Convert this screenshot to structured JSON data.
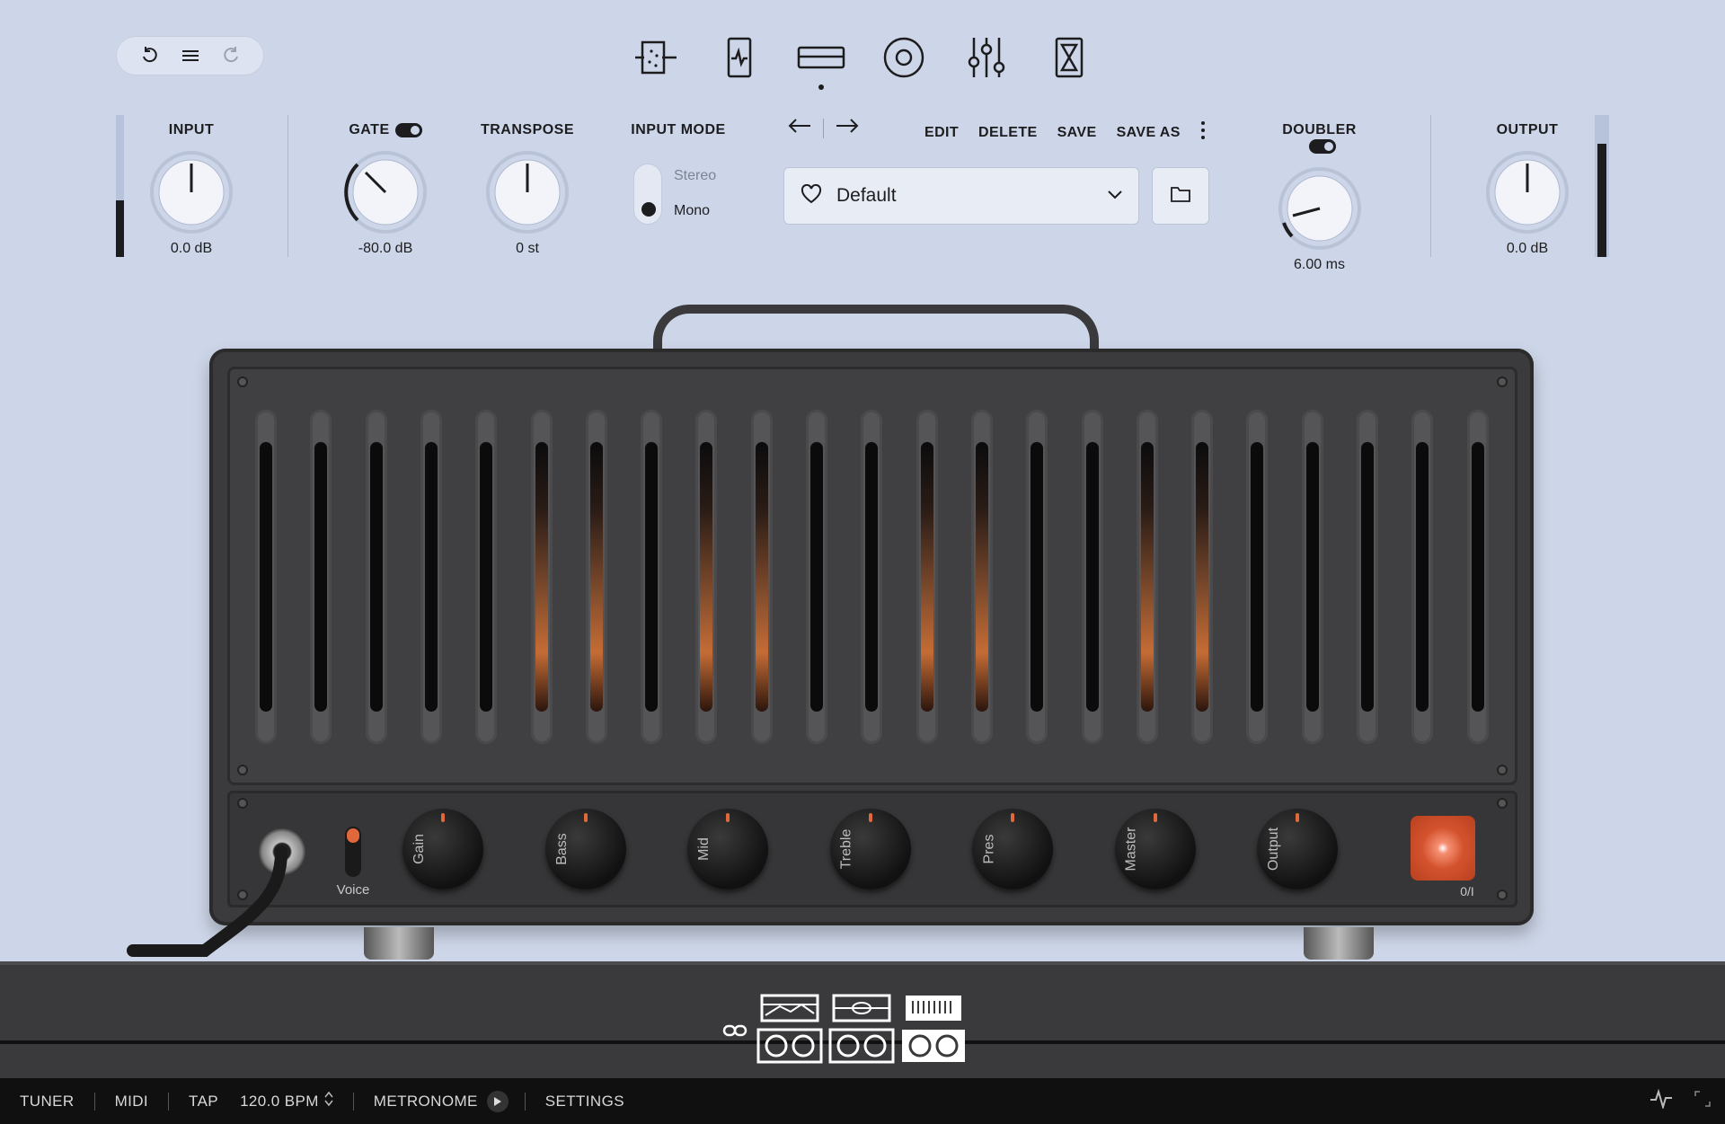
{
  "toolbar": {
    "undo_icon": "undo-icon",
    "menu_icon": "hamburger-icon",
    "redo_icon": "redo-icon"
  },
  "top_nav": {
    "items": [
      {
        "icon": "input-noise-icon"
      },
      {
        "icon": "pedal-icon"
      },
      {
        "icon": "amp-head-icon",
        "active": true
      },
      {
        "icon": "speaker-cab-icon"
      },
      {
        "icon": "mixer-sliders-icon"
      },
      {
        "icon": "hourglass-icon"
      }
    ]
  },
  "controls": {
    "input": {
      "label": "INPUT",
      "value": "0.0 dB"
    },
    "gate": {
      "label": "GATE",
      "value": "-80.0 dB",
      "enabled": true
    },
    "transpose": {
      "label": "TRANSPOSE",
      "value": "0 st"
    },
    "input_mode": {
      "label": "INPUT MODE",
      "options": [
        "Stereo",
        "Mono"
      ],
      "selected": "Mono"
    },
    "doubler": {
      "label": "DOUBLER",
      "value": "6.00 ms",
      "enabled": true
    },
    "output": {
      "label": "OUTPUT",
      "value": "0.0 dB"
    }
  },
  "meters": {
    "input_level": 0.4,
    "output_level": 0.8
  },
  "preset": {
    "name": "Default",
    "edit": "EDIT",
    "delete": "DELETE",
    "save": "SAVE",
    "save_as": "SAVE AS"
  },
  "amp": {
    "voice_label": "Voice",
    "power_label": "0/I",
    "knobs": [
      "Gain",
      "Bass",
      "Mid",
      "Treble",
      "Pres",
      "Master",
      "Output"
    ],
    "accent": "#e0683a"
  },
  "bottom_bar": {
    "tuner": "TUNER",
    "midi": "MIDI",
    "tap": "TAP",
    "bpm": "120.0 BPM",
    "metronome": "METRONOME",
    "settings": "SETTINGS"
  }
}
